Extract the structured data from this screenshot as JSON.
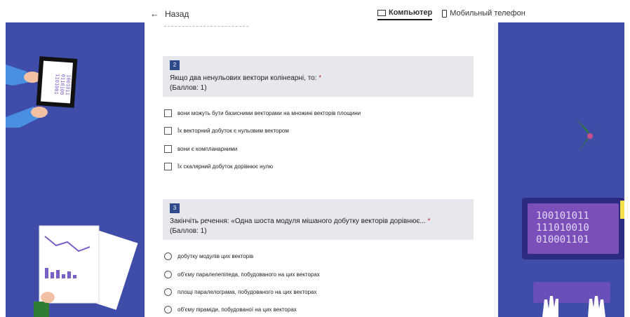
{
  "nav": {
    "back_label": "Назад",
    "views": [
      {
        "label": "Компьютер",
        "active": true
      },
      {
        "label": "Мобильный телефон",
        "active": false
      }
    ]
  },
  "questions": [
    {
      "number": "2",
      "text": "Якщо два ненульових вектори колінеарні, то:",
      "required_mark": "*",
      "score": "(Баллов: 1)",
      "type": "checkbox",
      "options": [
        "вони можуть бути базисними векторами на множині векторів площини",
        "Їх векторний добуток є нульовим вектором",
        "вони є компланарними",
        "Їх скалярний добуток дорівнює нулю"
      ]
    },
    {
      "number": "3",
      "text": "Закінчіть речення: «Одна шоста модуля  мішаного добутку векторів дорівнює...",
      "required_mark": "*",
      "score": "(Баллов: 1)",
      "type": "radio",
      "options": [
        "добутку модулів цих векторів",
        "об'єму паралелепіпеда, побудованого на цих векторах",
        "площі паралелограма, побудованого на цих векторах",
        "об'єму піраміди, побудованої на цих векторах"
      ]
    }
  ],
  "decor": {
    "binary_lines": [
      "100101011",
      "111010010",
      "010001101"
    ],
    "background_color": "#3f4ca8"
  }
}
